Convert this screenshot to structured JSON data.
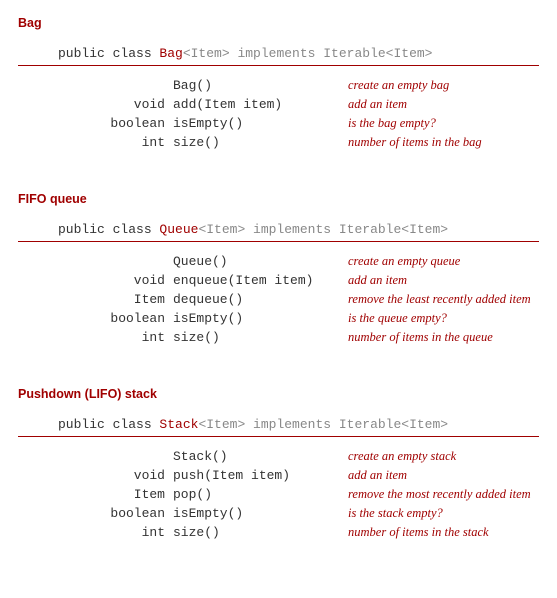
{
  "apis": [
    {
      "title": "Bag",
      "decl": {
        "prefix": "public class ",
        "name": "Bag",
        "generic": "<Item>",
        "suffix": " implements Iterable<Item>"
      },
      "methods": [
        {
          "ret": "",
          "sig": "Bag()",
          "desc": "create an empty bag"
        },
        {
          "ret": "void",
          "sig": "add(Item item)",
          "desc": "add an item"
        },
        {
          "ret": "boolean",
          "sig": "isEmpty()",
          "desc": "is the bag empty?"
        },
        {
          "ret": "int",
          "sig": "size()",
          "desc": "number of items in the bag"
        }
      ]
    },
    {
      "title": "FIFO queue",
      "decl": {
        "prefix": "public class ",
        "name": "Queue",
        "generic": "<Item>",
        "suffix": " implements Iterable<Item>"
      },
      "methods": [
        {
          "ret": "",
          "sig": "Queue()",
          "desc": "create an empty queue"
        },
        {
          "ret": "void",
          "sig": "enqueue(Item item)",
          "desc": "add an item"
        },
        {
          "ret": "Item",
          "sig": "dequeue()",
          "desc": "remove the least recently added item"
        },
        {
          "ret": "boolean",
          "sig": "isEmpty()",
          "desc": "is the queue empty?"
        },
        {
          "ret": "int",
          "sig": "size()",
          "desc": "number of items in the queue"
        }
      ]
    },
    {
      "title": "Pushdown (LIFO) stack",
      "decl": {
        "prefix": "public class ",
        "name": "Stack",
        "generic": "<Item>",
        "suffix": " implements Iterable<Item>"
      },
      "methods": [
        {
          "ret": "",
          "sig": "Stack()",
          "desc": "create an empty stack"
        },
        {
          "ret": "void",
          "sig": "push(Item item)",
          "desc": "add an item"
        },
        {
          "ret": "Item",
          "sig": "pop()",
          "desc": "remove the most recently added item"
        },
        {
          "ret": "boolean",
          "sig": "isEmpty()",
          "desc": "is the stack empty?"
        },
        {
          "ret": "int",
          "sig": "size()",
          "desc": "number of items in the stack"
        }
      ]
    }
  ]
}
